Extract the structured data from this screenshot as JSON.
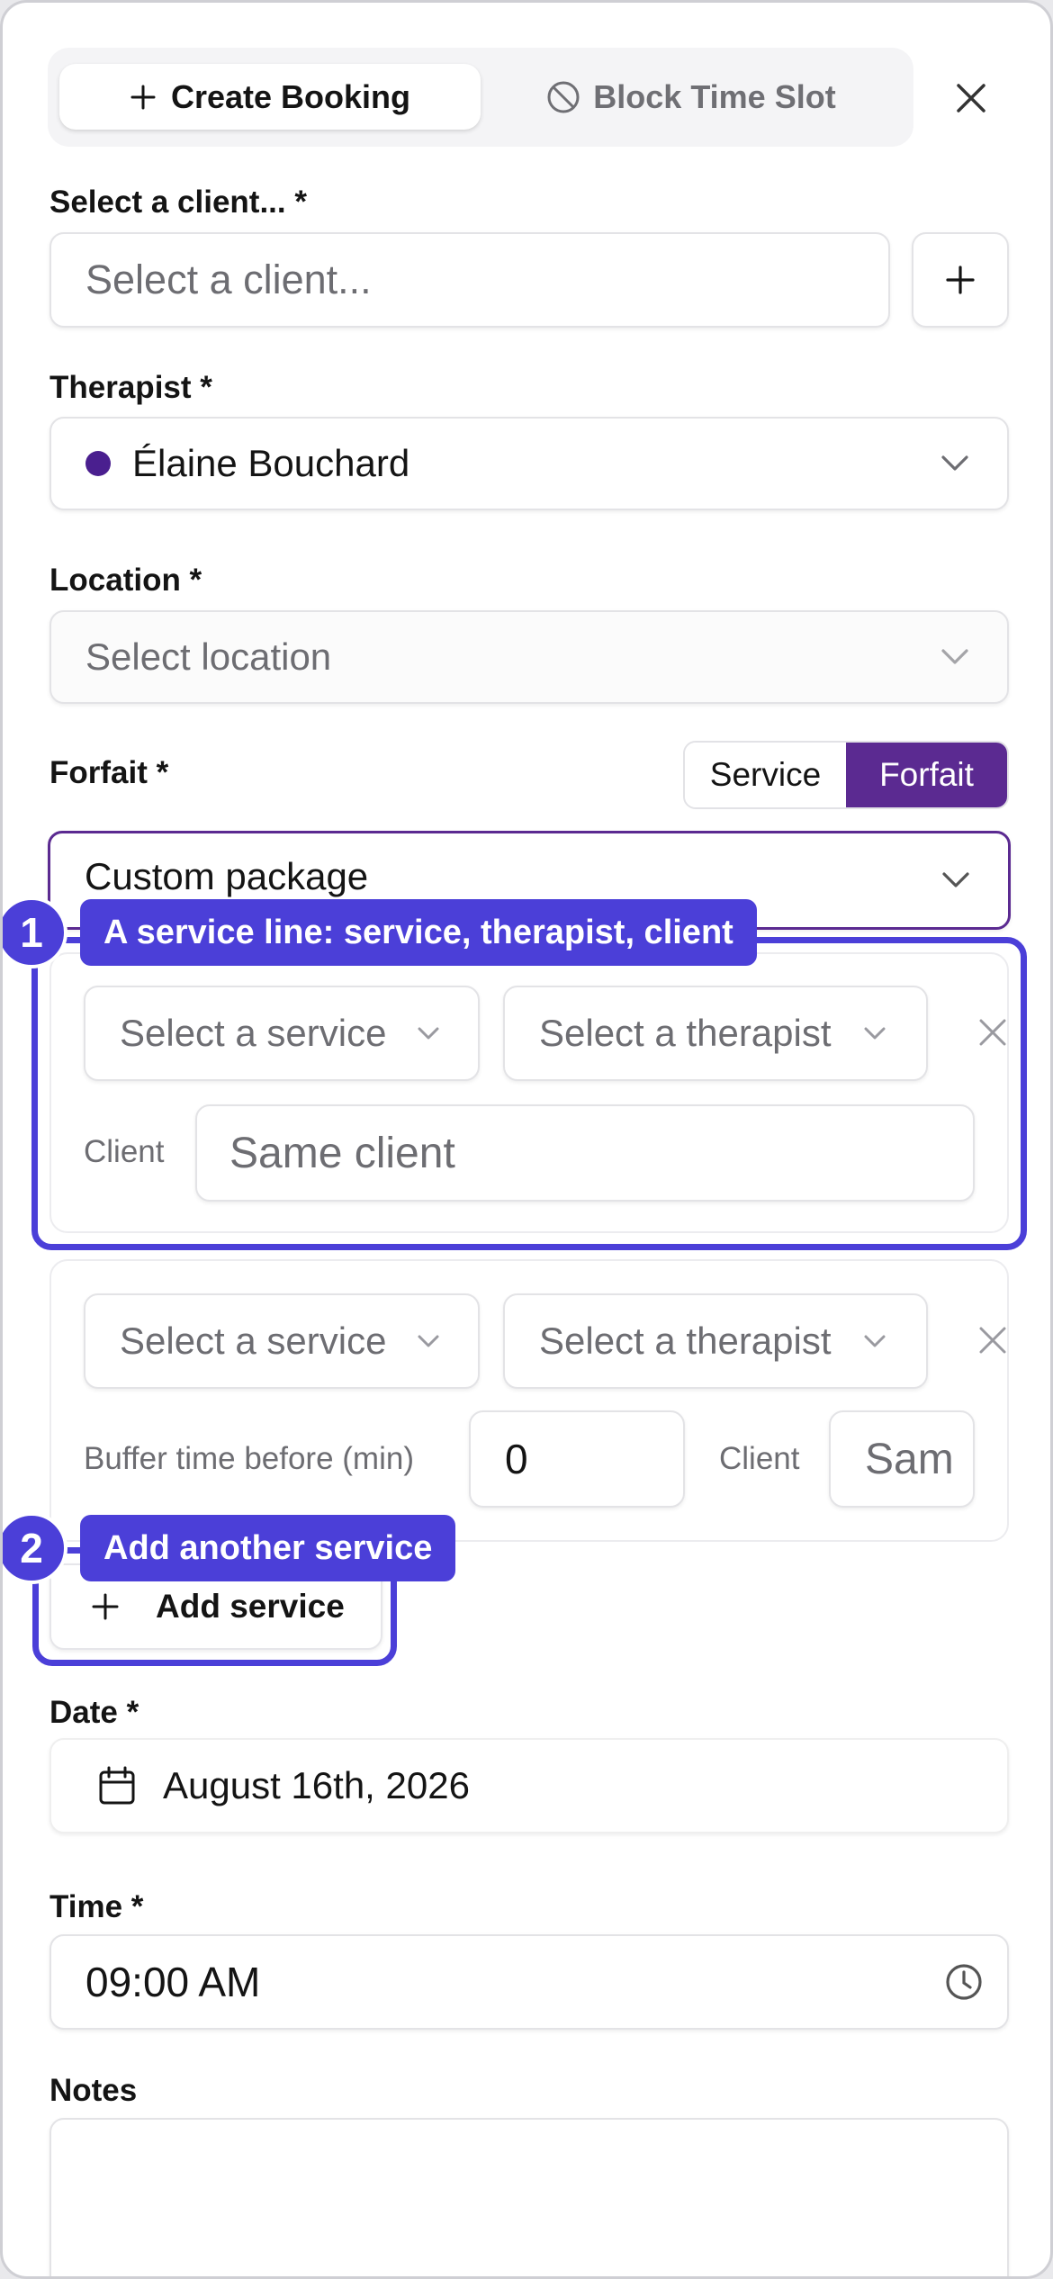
{
  "tabs": {
    "create_booking": "Create Booking",
    "block_time_slot": "Block Time Slot"
  },
  "client": {
    "label": "Select a client... *",
    "placeholder": "Select a client..."
  },
  "therapist": {
    "label": "Therapist *",
    "value": "Élaine Bouchard",
    "dot_color": "#4a1f8f"
  },
  "location": {
    "label": "Location *",
    "placeholder": "Select location"
  },
  "forfait": {
    "label": "Forfait *",
    "toggle_service": "Service",
    "toggle_forfait": "Forfait",
    "selected": "Custom package"
  },
  "service_lines": [
    {
      "service_placeholder": "Select a service",
      "therapist_placeholder": "Select a therapist",
      "client_label": "Client",
      "client_placeholder": "Same client"
    },
    {
      "service_placeholder": "Select a service",
      "therapist_placeholder": "Select a therapist",
      "buffer_label": "Buffer time before (min)",
      "buffer_value": "0",
      "client_label": "Client",
      "client_placeholder": "Sam"
    }
  ],
  "add_service_label": "Add service",
  "date": {
    "label": "Date *",
    "value": "August 16th, 2026"
  },
  "time": {
    "label": "Time *",
    "value": "09:00 AM"
  },
  "notes": {
    "label": "Notes"
  },
  "annotations": [
    {
      "number": "1",
      "text": "A service line: service, therapist, client"
    },
    {
      "number": "2",
      "text": "Add another service"
    }
  ],
  "colors": {
    "accent_purple": "#5b2a91",
    "annotation_blue": "#4b3fd8"
  }
}
